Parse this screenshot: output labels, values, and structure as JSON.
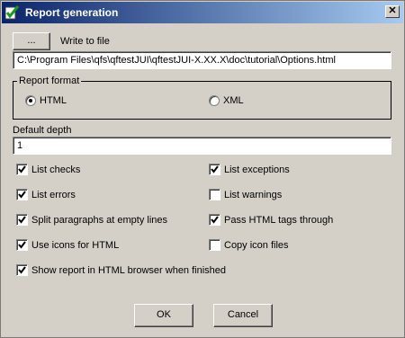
{
  "window": {
    "title": "Report generation"
  },
  "file": {
    "browse_label": "...",
    "write_label": "Write to file",
    "path": "C:\\Program Files\\qfs\\qftestJUI\\qftestJUI-X.XX.X\\doc\\tutorial\\Options.html"
  },
  "format": {
    "legend": "Report format",
    "html_label": "HTML",
    "xml_label": "XML",
    "selected": "HTML"
  },
  "depth": {
    "label": "Default depth",
    "value": "1"
  },
  "options": {
    "list_checks": {
      "label": "List checks",
      "checked": true
    },
    "list_exceptions": {
      "label": "List exceptions",
      "checked": true
    },
    "list_errors": {
      "label": "List errors",
      "checked": true
    },
    "list_warnings": {
      "label": "List warnings",
      "checked": false
    },
    "split_paragraphs": {
      "label": "Split paragraphs at empty lines",
      "checked": true
    },
    "pass_html": {
      "label": "Pass HTML tags through",
      "checked": true
    },
    "use_icons": {
      "label": "Use icons for HTML",
      "checked": true
    },
    "copy_icons": {
      "label": "Copy icon files",
      "checked": false
    },
    "show_report": {
      "label": "Show report in HTML browser when finished",
      "checked": true
    }
  },
  "buttons": {
    "ok": "OK",
    "cancel": "Cancel"
  }
}
